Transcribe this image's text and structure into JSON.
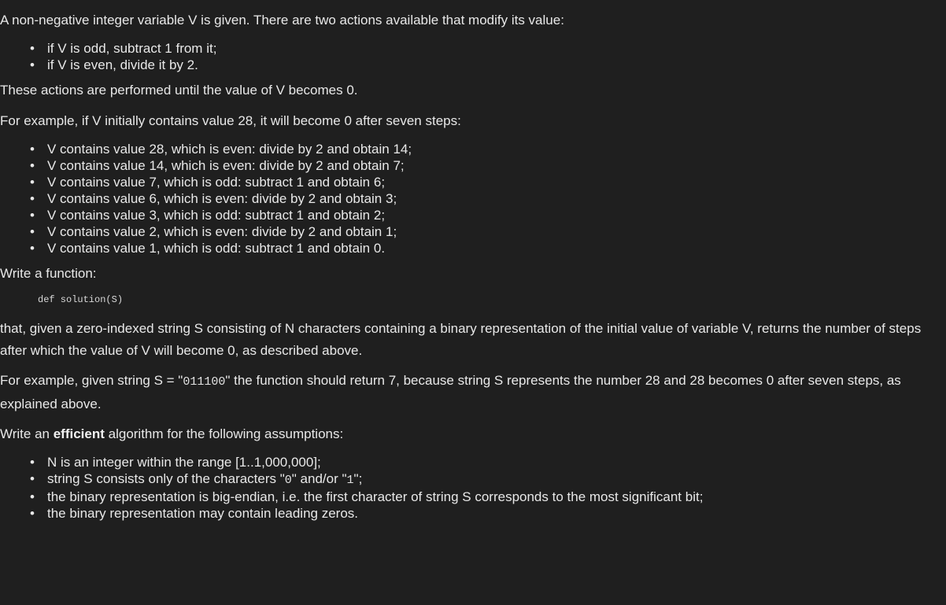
{
  "p1": "A non-negative integer variable V is given. There are two actions available that modify its value:",
  "actions": [
    "if V is odd, subtract 1 from it;",
    "if V is even, divide it by 2."
  ],
  "p2": "These actions are performed until the value of V becomes 0.",
  "p3": "For example, if V initially contains value 28, it will become 0 after seven steps:",
  "steps": [
    "V contains value 28, which is even: divide by 2 and obtain 14;",
    "V contains value 14, which is even: divide by 2 and obtain 7;",
    "V contains value 7, which is odd: subtract 1 and obtain 6;",
    "V contains value 6, which is even: divide by 2 and obtain 3;",
    "V contains value 3, which is odd: subtract 1 and obtain 2;",
    "V contains value 2, which is even: divide by 2 and obtain 1;",
    "V contains value 1, which is odd: subtract 1 and obtain 0."
  ],
  "p4": "Write a function:",
  "code": "def solution(S)",
  "p5": "that, given a zero-indexed string S consisting of N characters containing a binary representation of the initial value of variable V, returns the number of steps after which the value of V will become 0, as described above.",
  "p6": {
    "before": "For example, given string S = \"",
    "value": "011100",
    "after": "\" the function should return 7, because string S represents the number 28 and 28 becomes 0 after seven steps, as explained above."
  },
  "p7": {
    "before": "Write an ",
    "bold": "efficient",
    "after": " algorithm for the following assumptions:"
  },
  "assumptions": {
    "a1": "N is an integer within the range [1..1,000,000];",
    "a2": {
      "before": "string S consists only of the characters \"",
      "zero": "0",
      "mid": "\" and/or \"",
      "one": "1",
      "after": "\";"
    },
    "a3": "the binary representation is big-endian, i.e. the first character of string S corresponds to the most significant bit;",
    "a4": "the binary representation may contain leading zeros."
  }
}
